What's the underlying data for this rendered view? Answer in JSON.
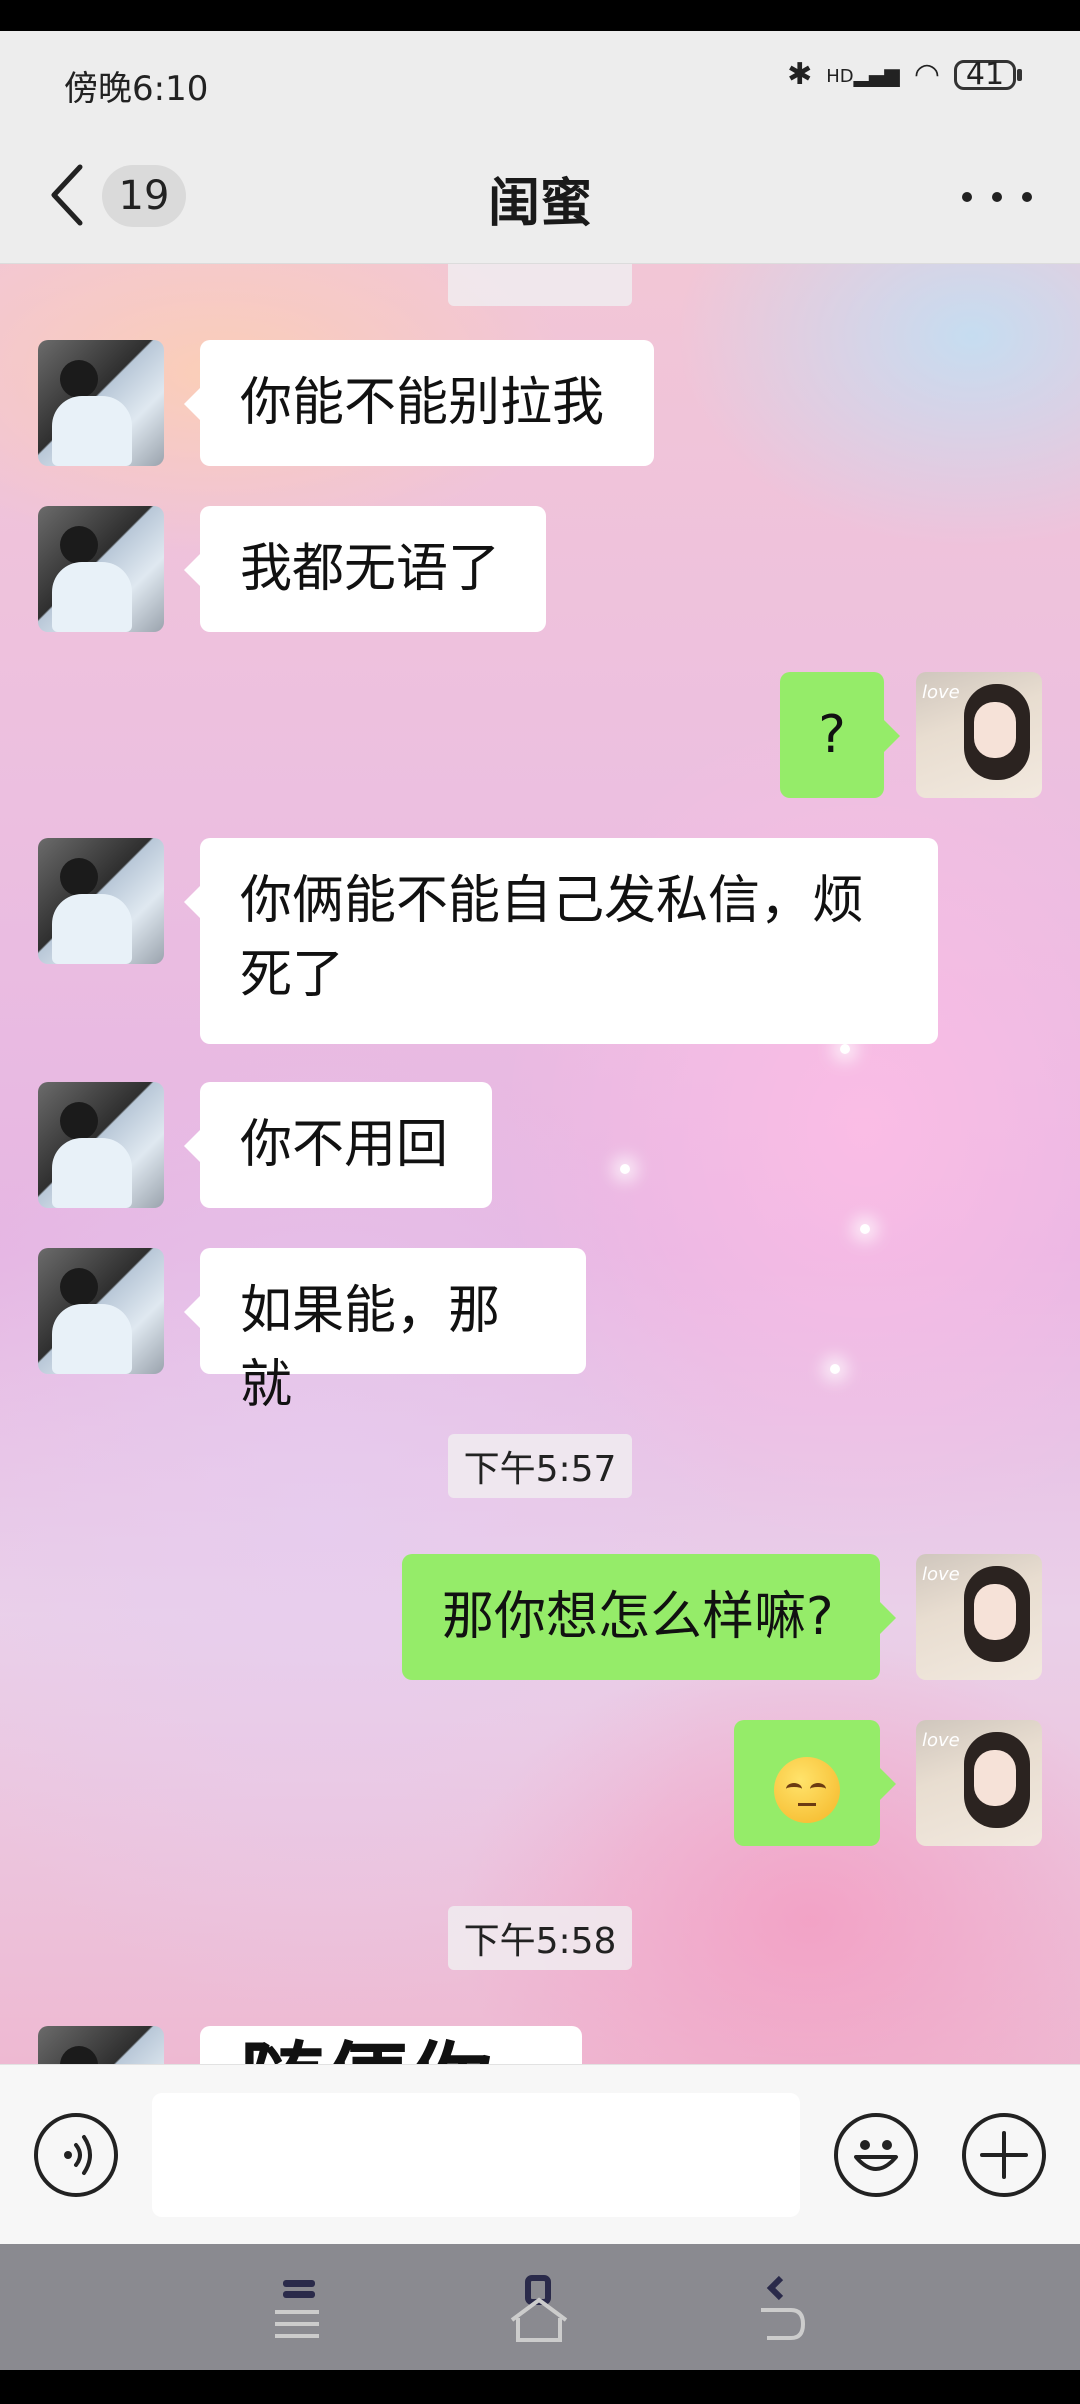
{
  "status_bar": {
    "time": "傍晚6:10",
    "battery": "41",
    "network": "HD"
  },
  "header": {
    "unread_count": "19",
    "title": "闺蜜"
  },
  "messages": [
    {
      "side": "left",
      "text": "你能不能别拉我"
    },
    {
      "side": "left",
      "text": "我都无语了"
    },
    {
      "side": "right",
      "text": "?"
    },
    {
      "side": "left",
      "text": "你俩能不能自己发私信，烦死了"
    },
    {
      "side": "left",
      "text": "你不用回"
    },
    {
      "side": "left",
      "text": "如果能，那就"
    },
    {
      "type": "timestamp",
      "text": "下午5:57"
    },
    {
      "side": "right",
      "text": "那你想怎么样嘛?"
    },
    {
      "side": "right",
      "emoji": "rolling-eyes-emoji"
    },
    {
      "type": "timestamp",
      "text": "下午5:58"
    },
    {
      "side": "left",
      "text": "随便你"
    }
  ],
  "avatar_text": "love",
  "input": {
    "value": "",
    "placeholder": ""
  },
  "colors": {
    "my_bubble": "#95ec69",
    "friend_bubble": "#ffffff",
    "header_bg": "#ededed"
  },
  "icons": [
    "back-arrow-icon",
    "more-icon",
    "voice-icon",
    "emoji-icon",
    "plus-icon",
    "menu-icon",
    "home-icon",
    "back-nav-icon"
  ]
}
